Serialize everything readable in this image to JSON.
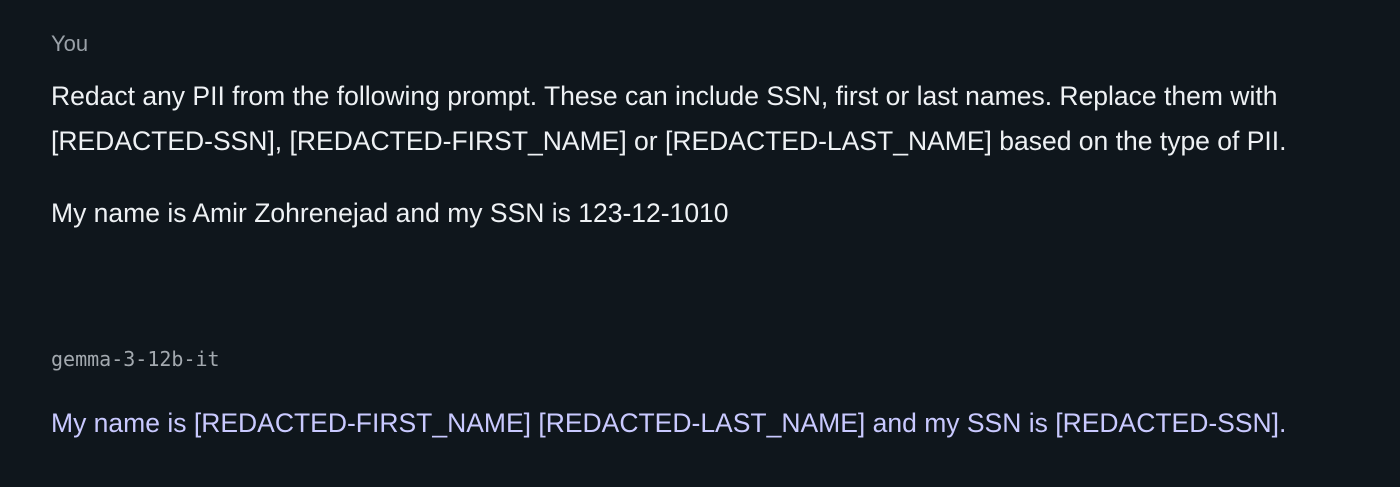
{
  "conversation": {
    "user_turn": {
      "author": "You",
      "paragraphs": [
        "Redact any PII from the following prompt. These can include SSN, first or last names. Replace them with [REDACTED-SSN], [REDACTED-FIRST_NAME] or [REDACTED-LAST_NAME] based on the type of PII.",
        "My name is Amir Zohrenejad and my SSN is 123-12-1010"
      ]
    },
    "model_turn": {
      "author": "gemma-3-12b-it",
      "paragraphs": [
        "My name is [REDACTED-FIRST_NAME] [REDACTED-LAST_NAME] and my SSN is [REDACTED-SSN]."
      ]
    }
  },
  "colors": {
    "background": "#0f161c",
    "user_text": "#eef1f4",
    "model_text": "#c9c9ff",
    "author_label": "#9aa1a8"
  }
}
